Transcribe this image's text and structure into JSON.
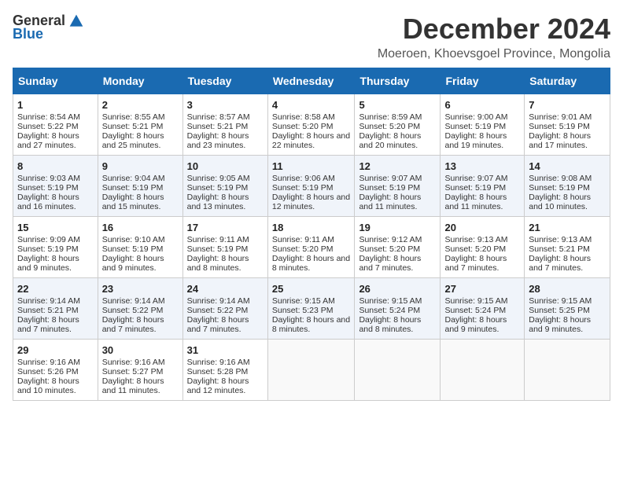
{
  "logo": {
    "general": "General",
    "blue": "Blue"
  },
  "title": "December 2024",
  "subtitle": "Moeroen, Khoevsgoel Province, Mongolia",
  "days_header": [
    "Sunday",
    "Monday",
    "Tuesday",
    "Wednesday",
    "Thursday",
    "Friday",
    "Saturday"
  ],
  "weeks": [
    [
      {
        "day": "1",
        "sunrise": "Sunrise: 8:54 AM",
        "sunset": "Sunset: 5:22 PM",
        "daylight": "Daylight: 8 hours and 27 minutes."
      },
      {
        "day": "2",
        "sunrise": "Sunrise: 8:55 AM",
        "sunset": "Sunset: 5:21 PM",
        "daylight": "Daylight: 8 hours and 25 minutes."
      },
      {
        "day": "3",
        "sunrise": "Sunrise: 8:57 AM",
        "sunset": "Sunset: 5:21 PM",
        "daylight": "Daylight: 8 hours and 23 minutes."
      },
      {
        "day": "4",
        "sunrise": "Sunrise: 8:58 AM",
        "sunset": "Sunset: 5:20 PM",
        "daylight": "Daylight: 8 hours and 22 minutes."
      },
      {
        "day": "5",
        "sunrise": "Sunrise: 8:59 AM",
        "sunset": "Sunset: 5:20 PM",
        "daylight": "Daylight: 8 hours and 20 minutes."
      },
      {
        "day": "6",
        "sunrise": "Sunrise: 9:00 AM",
        "sunset": "Sunset: 5:19 PM",
        "daylight": "Daylight: 8 hours and 19 minutes."
      },
      {
        "day": "7",
        "sunrise": "Sunrise: 9:01 AM",
        "sunset": "Sunset: 5:19 PM",
        "daylight": "Daylight: 8 hours and 17 minutes."
      }
    ],
    [
      {
        "day": "8",
        "sunrise": "Sunrise: 9:03 AM",
        "sunset": "Sunset: 5:19 PM",
        "daylight": "Daylight: 8 hours and 16 minutes."
      },
      {
        "day": "9",
        "sunrise": "Sunrise: 9:04 AM",
        "sunset": "Sunset: 5:19 PM",
        "daylight": "Daylight: 8 hours and 15 minutes."
      },
      {
        "day": "10",
        "sunrise": "Sunrise: 9:05 AM",
        "sunset": "Sunset: 5:19 PM",
        "daylight": "Daylight: 8 hours and 13 minutes."
      },
      {
        "day": "11",
        "sunrise": "Sunrise: 9:06 AM",
        "sunset": "Sunset: 5:19 PM",
        "daylight": "Daylight: 8 hours and 12 minutes."
      },
      {
        "day": "12",
        "sunrise": "Sunrise: 9:07 AM",
        "sunset": "Sunset: 5:19 PM",
        "daylight": "Daylight: 8 hours and 11 minutes."
      },
      {
        "day": "13",
        "sunrise": "Sunrise: 9:07 AM",
        "sunset": "Sunset: 5:19 PM",
        "daylight": "Daylight: 8 hours and 11 minutes."
      },
      {
        "day": "14",
        "sunrise": "Sunrise: 9:08 AM",
        "sunset": "Sunset: 5:19 PM",
        "daylight": "Daylight: 8 hours and 10 minutes."
      }
    ],
    [
      {
        "day": "15",
        "sunrise": "Sunrise: 9:09 AM",
        "sunset": "Sunset: 5:19 PM",
        "daylight": "Daylight: 8 hours and 9 minutes."
      },
      {
        "day": "16",
        "sunrise": "Sunrise: 9:10 AM",
        "sunset": "Sunset: 5:19 PM",
        "daylight": "Daylight: 8 hours and 9 minutes."
      },
      {
        "day": "17",
        "sunrise": "Sunrise: 9:11 AM",
        "sunset": "Sunset: 5:19 PM",
        "daylight": "Daylight: 8 hours and 8 minutes."
      },
      {
        "day": "18",
        "sunrise": "Sunrise: 9:11 AM",
        "sunset": "Sunset: 5:20 PM",
        "daylight": "Daylight: 8 hours and 8 minutes."
      },
      {
        "day": "19",
        "sunrise": "Sunrise: 9:12 AM",
        "sunset": "Sunset: 5:20 PM",
        "daylight": "Daylight: 8 hours and 7 minutes."
      },
      {
        "day": "20",
        "sunrise": "Sunrise: 9:13 AM",
        "sunset": "Sunset: 5:20 PM",
        "daylight": "Daylight: 8 hours and 7 minutes."
      },
      {
        "day": "21",
        "sunrise": "Sunrise: 9:13 AM",
        "sunset": "Sunset: 5:21 PM",
        "daylight": "Daylight: 8 hours and 7 minutes."
      }
    ],
    [
      {
        "day": "22",
        "sunrise": "Sunrise: 9:14 AM",
        "sunset": "Sunset: 5:21 PM",
        "daylight": "Daylight: 8 hours and 7 minutes."
      },
      {
        "day": "23",
        "sunrise": "Sunrise: 9:14 AM",
        "sunset": "Sunset: 5:22 PM",
        "daylight": "Daylight: 8 hours and 7 minutes."
      },
      {
        "day": "24",
        "sunrise": "Sunrise: 9:14 AM",
        "sunset": "Sunset: 5:22 PM",
        "daylight": "Daylight: 8 hours and 7 minutes."
      },
      {
        "day": "25",
        "sunrise": "Sunrise: 9:15 AM",
        "sunset": "Sunset: 5:23 PM",
        "daylight": "Daylight: 8 hours and 8 minutes."
      },
      {
        "day": "26",
        "sunrise": "Sunrise: 9:15 AM",
        "sunset": "Sunset: 5:24 PM",
        "daylight": "Daylight: 8 hours and 8 minutes."
      },
      {
        "day": "27",
        "sunrise": "Sunrise: 9:15 AM",
        "sunset": "Sunset: 5:24 PM",
        "daylight": "Daylight: 8 hours and 9 minutes."
      },
      {
        "day": "28",
        "sunrise": "Sunrise: 9:15 AM",
        "sunset": "Sunset: 5:25 PM",
        "daylight": "Daylight: 8 hours and 9 minutes."
      }
    ],
    [
      {
        "day": "29",
        "sunrise": "Sunrise: 9:16 AM",
        "sunset": "Sunset: 5:26 PM",
        "daylight": "Daylight: 8 hours and 10 minutes."
      },
      {
        "day": "30",
        "sunrise": "Sunrise: 9:16 AM",
        "sunset": "Sunset: 5:27 PM",
        "daylight": "Daylight: 8 hours and 11 minutes."
      },
      {
        "day": "31",
        "sunrise": "Sunrise: 9:16 AM",
        "sunset": "Sunset: 5:28 PM",
        "daylight": "Daylight: 8 hours and 12 minutes."
      },
      null,
      null,
      null,
      null
    ]
  ]
}
